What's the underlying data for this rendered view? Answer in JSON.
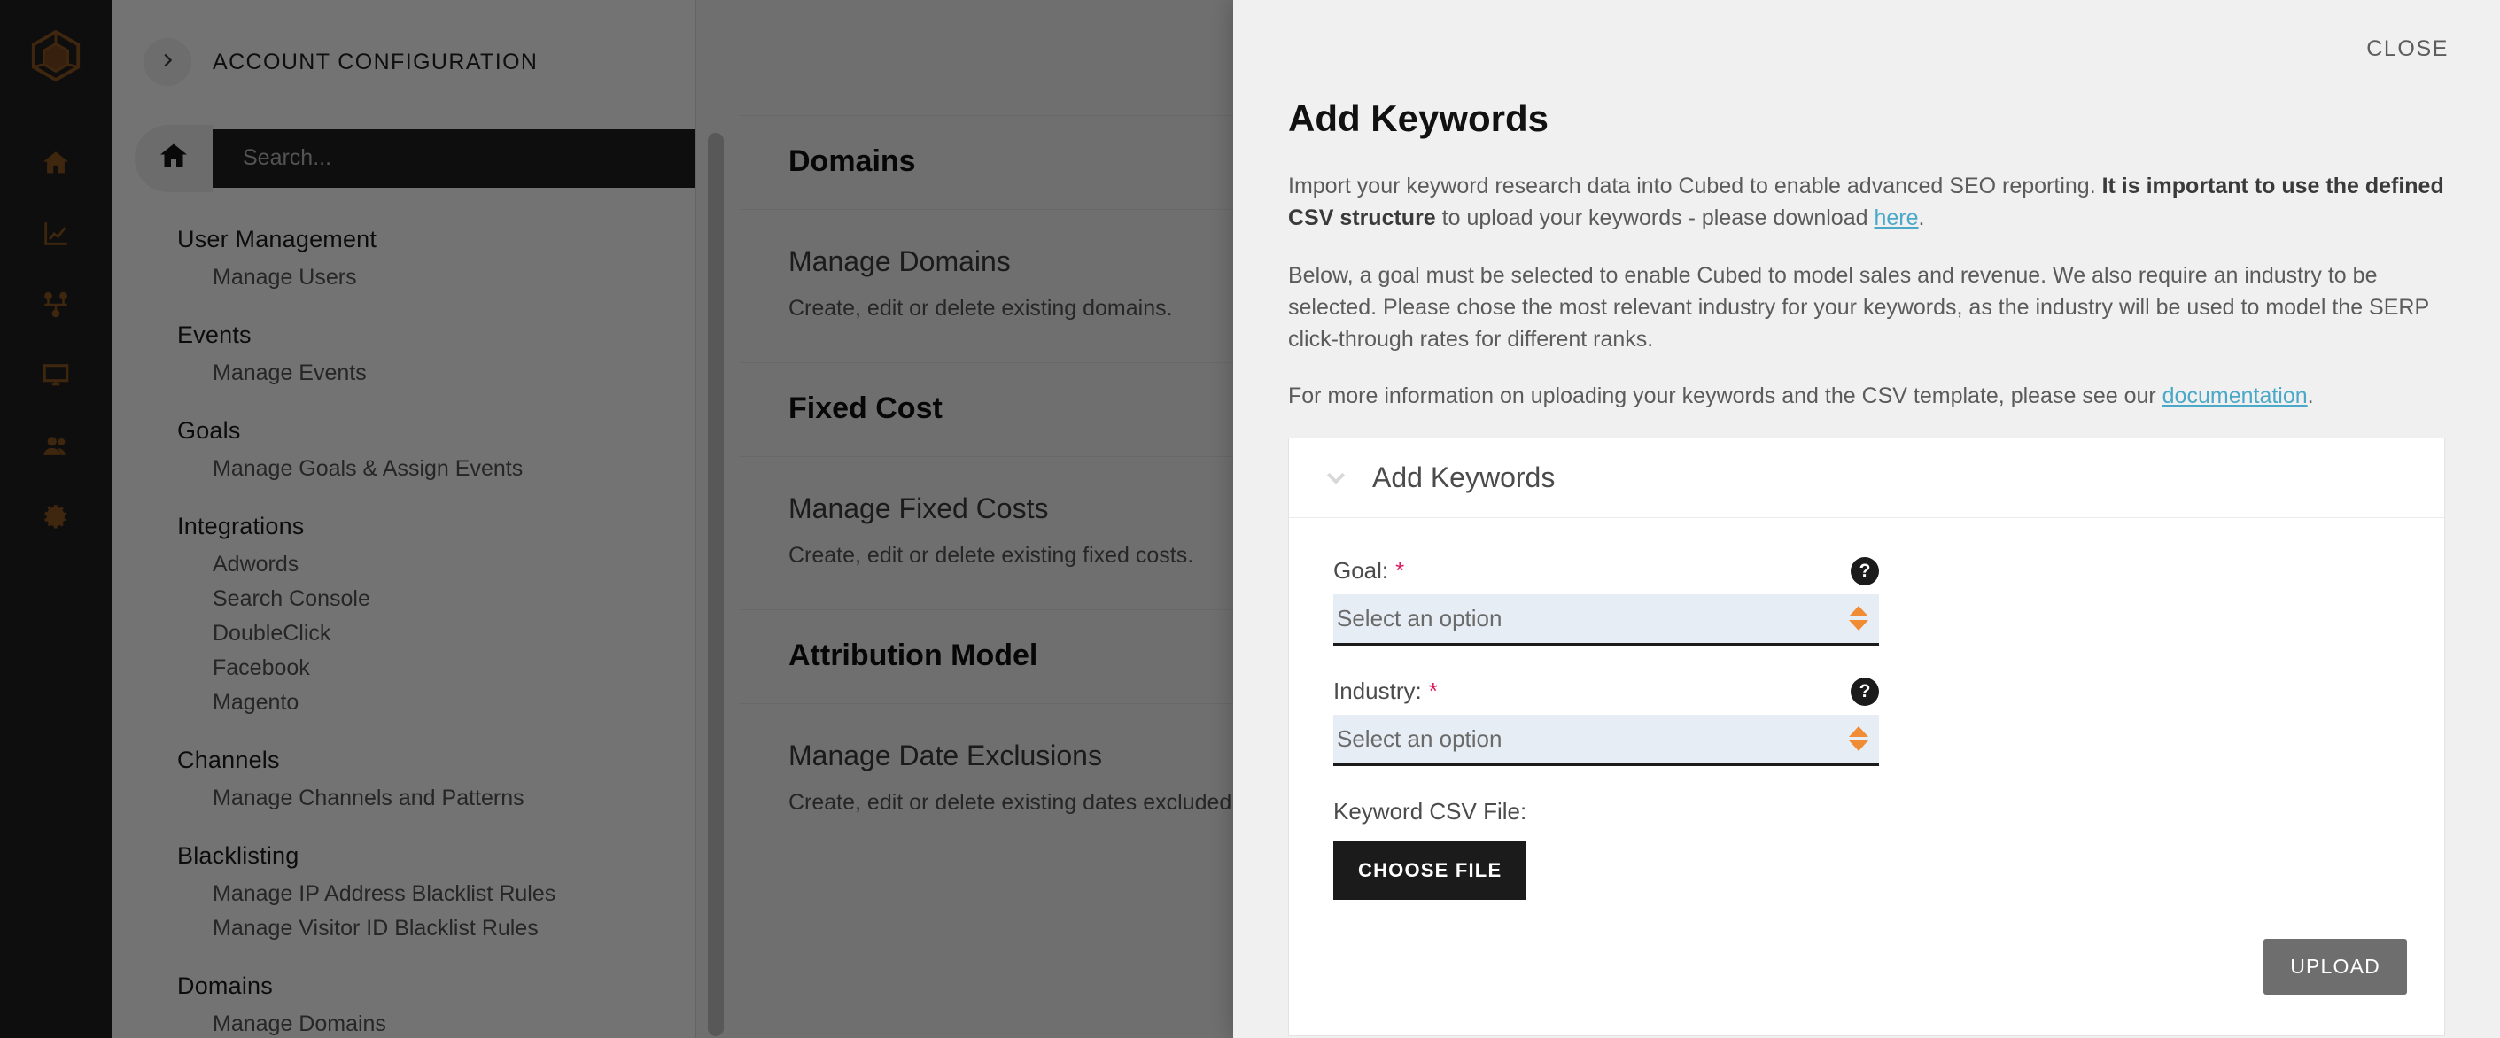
{
  "app": {
    "breadcrumb_title": "ACCOUNT CONFIGURATION",
    "rail_icons": [
      "home-icon",
      "chart-line-icon",
      "sitemap-icon",
      "monitor-icon",
      "users-icon",
      "gear-icon"
    ],
    "brand": "cubed-logo"
  },
  "search": {
    "placeholder": "Search...",
    "value": "",
    "home_icon": "home-icon"
  },
  "nav": {
    "groups": [
      {
        "title": "User Management",
        "items": [
          "Manage Users"
        ]
      },
      {
        "title": "Events",
        "items": [
          "Manage Events"
        ]
      },
      {
        "title": "Goals",
        "items": [
          "Manage Goals & Assign Events"
        ]
      },
      {
        "title": "Integrations",
        "items": [
          "Adwords",
          "Search Console",
          "DoubleClick",
          "Facebook",
          "Magento"
        ]
      },
      {
        "title": "Channels",
        "items": [
          "Manage Channels and Patterns"
        ]
      },
      {
        "title": "Blacklisting",
        "items": [
          "Manage IP Address Blacklist Rules",
          "Manage Visitor ID Blacklist Rules"
        ]
      },
      {
        "title": "Domains",
        "items": [
          "Manage Domains"
        ]
      }
    ]
  },
  "main": {
    "sections": [
      {
        "heading": "Domains",
        "card_title": "Manage Domains",
        "card_desc": "Create, edit or delete existing domains."
      },
      {
        "heading": "Fixed Cost",
        "card_title": "Manage Fixed Costs",
        "card_desc": "Create, edit or delete existing fixed costs."
      },
      {
        "heading": "Attribution Model",
        "card_title": "Manage Date Exclusions",
        "card_desc": "Create, edit or delete existing dates excluded."
      }
    ]
  },
  "modal": {
    "close_label": "CLOSE",
    "title": "Add Keywords",
    "paragraph1_part1": "Import your keyword research data into Cubed to enable advanced SEO reporting. ",
    "paragraph1_bold": "It is important to use the defined CSV structure",
    "paragraph1_part2": " to upload your keywords - please download ",
    "paragraph1_link": "here",
    "paragraph1_part3": ".",
    "paragraph2": "Below, a goal must be selected to enable Cubed to model sales and revenue. We also require an industry to be selected. Please chose the most relevant industry for your keywords, as the industry will be used to model the SERP click-through rates for different ranks.",
    "paragraph3_part1": "For more information on uploading your keywords and the CSV template, please see our ",
    "paragraph3_link": "documentation",
    "paragraph3_part2": ".",
    "card": {
      "header": "Add Keywords",
      "chevron": "chevron-down-icon",
      "goal": {
        "label": "Goal:",
        "required_mark": "*",
        "value": "Select an option",
        "help": "?"
      },
      "industry": {
        "label": "Industry:",
        "required_mark": "*",
        "value": "Select an option",
        "help": "?"
      },
      "file": {
        "label": "Keyword CSV File:",
        "button": "CHOOSE FILE"
      },
      "upload_button": "UPLOAD"
    }
  },
  "colors": {
    "brand_orange": "#8a5423",
    "rail_bg": "#1f1f1f",
    "accent_orange": "#f08c34",
    "required_pink": "#d81b60",
    "link_blue": "#4aa8c8",
    "select_bg": "#e7edf4",
    "upload_gray": "#6e6e6e"
  }
}
